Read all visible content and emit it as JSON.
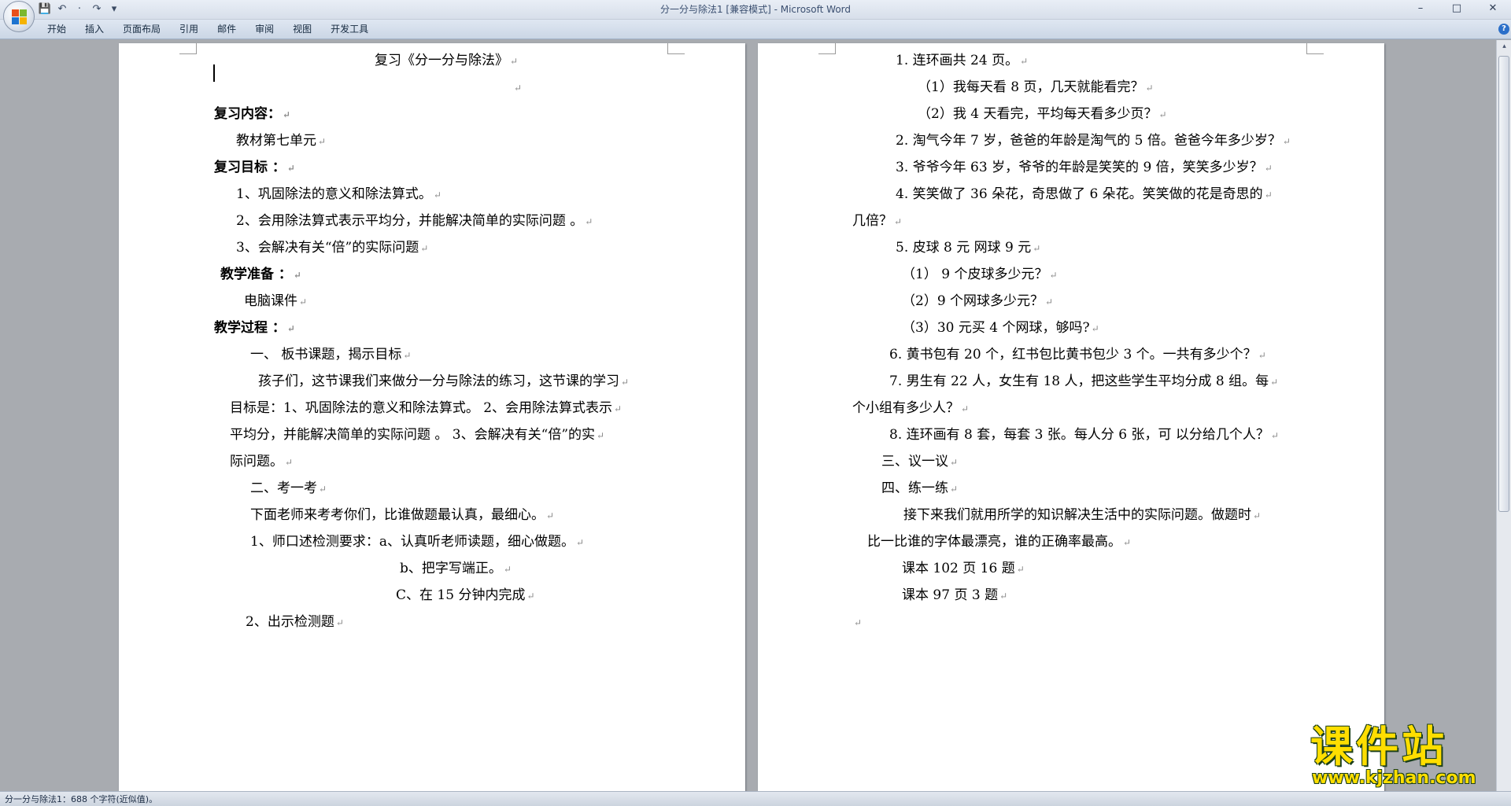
{
  "window": {
    "title": "分一分与除法1 [兼容模式] - Microsoft Word",
    "controls": [
      "–",
      "□",
      "✕"
    ]
  },
  "qat": {
    "save_icon": "💾",
    "undo_icon": "↶",
    "undo_sep": "·",
    "redo_icon": "↷",
    "customize_icon": "▾"
  },
  "ribbon": {
    "tabs": [
      "开始",
      "插入",
      "页面布局",
      "引用",
      "邮件",
      "审阅",
      "视图",
      "开发工具"
    ],
    "help": "?"
  },
  "document": {
    "pilcrow": "↵",
    "left_page": [
      {
        "text": "复习《分一分与除法》",
        "bold": false
      },
      {
        "text": "",
        "bold": false
      },
      {
        "text": "复习内容：",
        "bold": true
      },
      {
        "text": "教材第七单元",
        "bold": false
      },
      {
        "text": "复习目标 ：",
        "bold": true
      },
      {
        "text": "1、巩固除法的意义和除法算式。",
        "bold": false
      },
      {
        "text": "2、会用除法算式表示平均分，并能解决简单的实际问题 。",
        "bold": false
      },
      {
        "text": "3、会解决有关“倍”的实际问题",
        "bold": false
      },
      {
        "text": "教学准备 ：",
        "bold": true
      },
      {
        "text": "电脑课件",
        "bold": false
      },
      {
        "text": "教学过程 ：",
        "bold": true
      },
      {
        "text": "一、  板书课题，揭示目标",
        "bold": false
      },
      {
        "text": "孩子们，这节课我们来做分一分与除法的练习，这节课的学习",
        "bold": false
      },
      {
        "text": "目标是：1、巩固除法的意义和除法算式。 2、会用除法算式表示",
        "bold": false
      },
      {
        "text": "平均分，并能解决简单的实际问题  。  3、会解决有关“倍”的实",
        "bold": false
      },
      {
        "text": "际问题。",
        "bold": false
      },
      {
        "text": "二、考一考",
        "bold": false
      },
      {
        "text": "下面老师来考考你们，比谁做题最认真，最细心。",
        "bold": false
      },
      {
        "text": "1、师口述检测要求：a、认真听老师读题，细心做题。",
        "bold": false
      },
      {
        "text": "b、把字写端正。",
        "bold": false
      },
      {
        "text": "C、在 15 分钟内完成",
        "bold": false
      },
      {
        "text": "2、出示检测题",
        "bold": false
      }
    ],
    "right_page": [
      {
        "text": "1. 连环画共 24 页。"
      },
      {
        "text": "（1）我每天看 8 页，几天就能看完？"
      },
      {
        "text": "（2）我 4 天看完，平均每天看多少页？"
      },
      {
        "text": "2. 淘气今年 7 岁，爸爸的年龄是淘气的 5 倍。爸爸今年多少岁？"
      },
      {
        "text": "3. 爷爷今年 63 岁，爷爷的年龄是笑笑的 9 倍，笑笑多少岁？"
      },
      {
        "text": "4. 笑笑做了 36 朵花，奇思做了 6 朵花。笑笑做的花是奇思的"
      },
      {
        "text": "几倍？"
      },
      {
        "text": "5. 皮球 8 元         网球 9 元"
      },
      {
        "text": "（1）  9 个皮球多少元？"
      },
      {
        "text": "（2）9 个网球多少元？"
      },
      {
        "text": "（3）30 元买 4 个网球，够吗?"
      },
      {
        "text": "6. 黄书包有 20 个，红书包比黄书包少 3 个。一共有多少个？"
      },
      {
        "text": "7. 男生有 22 人，女生有 18 人，把这些学生平均分成 8 组。每"
      },
      {
        "text": "个小组有多少人？"
      },
      {
        "text": "8. 连环画有 8 套，每套 3 张。每人分 6 张，可  以分给几个人？"
      },
      {
        "text": "三、议一议"
      },
      {
        "text": "四、练一练"
      },
      {
        "text": "接下来我们就用所学的知识解决生活中的实际问题。做题时"
      },
      {
        "text": "比一比谁的字体最漂亮，谁的正确率最高。"
      },
      {
        "text": "课本 102 页 16 题"
      },
      {
        "text": "课本 97 页 3 题"
      },
      {
        "text": ""
      }
    ]
  },
  "statusbar": {
    "text": "分一分与除法1：688 个字符(近似值)。"
  },
  "watermark": {
    "cn": "课件站",
    "url": "www.kjzhan.com"
  }
}
